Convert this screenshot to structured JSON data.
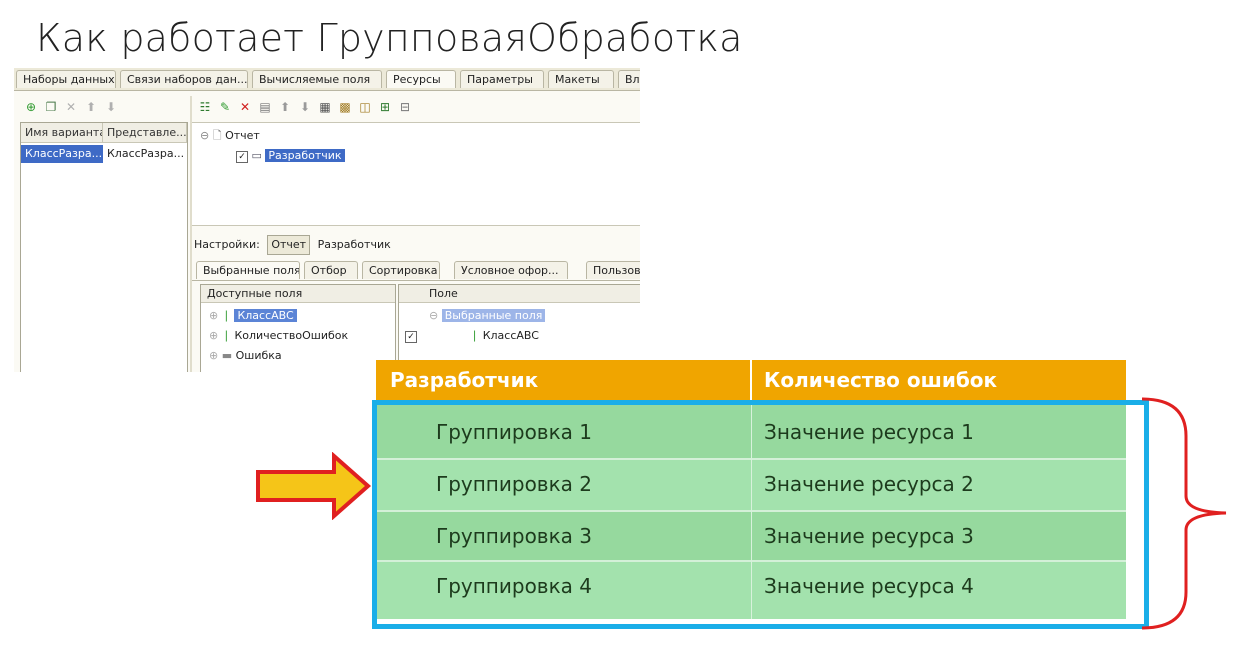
{
  "title": "Как работает ГрупповаяОбработка",
  "window": {
    "tabs": [
      "Наборы данных",
      "Связи наборов дан...",
      "Вычисляемые поля",
      "Ресурсы",
      "Параметры",
      "Макеты",
      "Вл"
    ],
    "variants": {
      "headers": [
        "Имя варианта",
        "Представле..."
      ],
      "row": [
        "КлассРазра...",
        "КлассРазра..."
      ]
    },
    "structure": {
      "root": "Отчет",
      "child": "Разработчик"
    },
    "settings": {
      "label": "Настройки:",
      "current": "Отчет",
      "next": "Разработчик"
    },
    "settings_tabs": [
      "Выбранные поля",
      "Отбор",
      "Сортировка",
      "Условное офор...",
      "Пользоват"
    ],
    "available_fields": {
      "header": "Доступные поля",
      "items": [
        "КлассABC",
        "КоличествоОшибок",
        "Ошибка"
      ]
    },
    "selected_fields": {
      "header": "Поле",
      "group": "Выбранные поля",
      "item": "КлассABC"
    }
  },
  "table": {
    "headers": [
      "Разработчик",
      "Количество ошибок"
    ],
    "rows": [
      [
        "Группировка 1",
        "Значение ресурса 1"
      ],
      [
        "Группировка 2",
        "Значение ресурса 2"
      ],
      [
        "Группировка 3",
        "Значение ресурса 3"
      ],
      [
        "Группировка 4",
        "Значение ресурса 4"
      ]
    ]
  },
  "colors": {
    "header_orange": "#f0a500",
    "frame_blue": "#1aaee8",
    "row_green_dark": "#96d99e",
    "row_green_light": "#a3e2ad",
    "arrow_yellow": "#f5c518",
    "arrow_red": "#e02020",
    "brace_red": "#e02020",
    "selection_blue": "#3e6ac6"
  }
}
